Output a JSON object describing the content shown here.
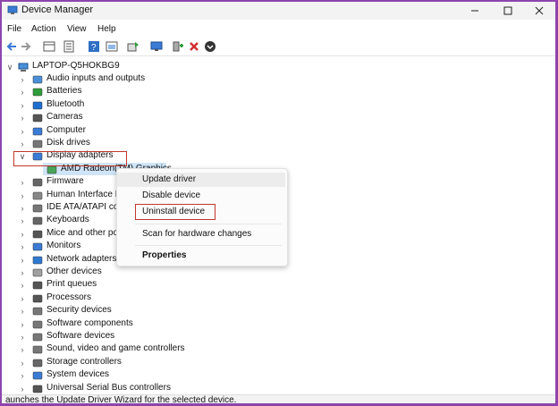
{
  "window": {
    "title": "Device Manager"
  },
  "menu": [
    "File",
    "Action",
    "View",
    "Help"
  ],
  "toolbar_icons": [
    "back-arrow-icon",
    "forward-arrow-icon",
    "properties-grid-icon",
    "list-view-icon",
    "help-icon",
    "device-view-icon",
    "scan-hardware-icon",
    "monitor-icon",
    "add-driver-icon",
    "uninstall-x-icon",
    "download-driver-icon"
  ],
  "tree": {
    "root": "LAPTOP-Q5HOKBG9",
    "categories": [
      "Audio inputs and outputs",
      "Batteries",
      "Bluetooth",
      "Cameras",
      "Computer",
      "Disk drives",
      "Display adapters",
      "Firmware",
      "Human Interface De",
      "IDE ATA/ATAPI cont",
      "Keyboards",
      "Mice and other point",
      "Monitors",
      "Network adapters",
      "Other devices",
      "Print queues",
      "Processors",
      "Security devices",
      "Software components",
      "Software devices",
      "Sound, video and game controllers",
      "Storage controllers",
      "System devices",
      "Universal Serial Bus controllers"
    ],
    "child_device": "AMD Radeon(TM) Graphics"
  },
  "context_menu": {
    "update": "Update driver",
    "disable": "Disable device",
    "uninstall": "Uninstall device",
    "scan": "Scan for hardware changes",
    "properties": "Properties"
  },
  "status": "aunches the Update Driver Wizard for the selected device.",
  "colors": {
    "accent": "#0067c0",
    "highlight_border": "#c0392b",
    "frame": "#8e44ad",
    "selection": "#cfe5f7"
  }
}
